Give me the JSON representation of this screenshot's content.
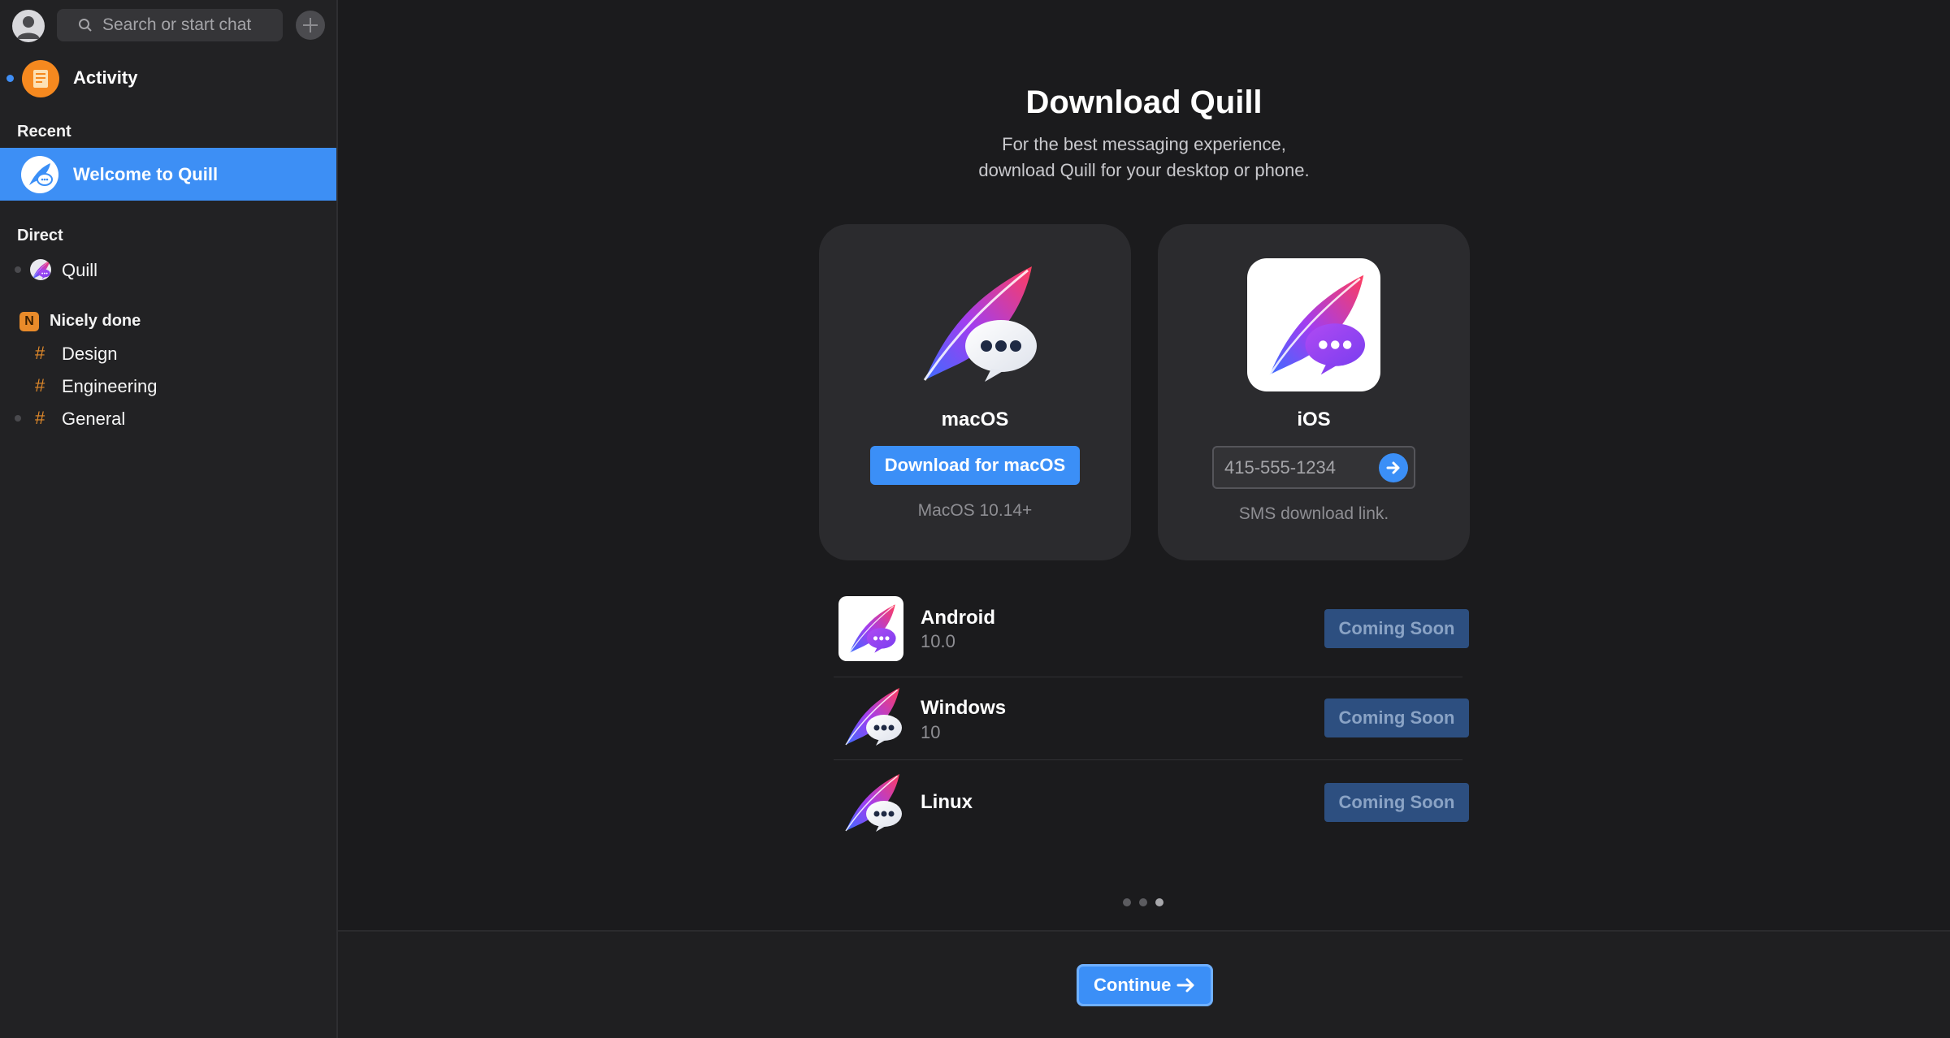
{
  "sidebar": {
    "search_placeholder": "Search or start chat",
    "activity_label": "Activity",
    "recent_title": "Recent",
    "recent_item": "Welcome to Quill",
    "direct_title": "Direct",
    "direct_item": "Quill",
    "team_badge": "N",
    "team_name": "Nicely done",
    "channels": [
      {
        "hash": "#",
        "name": "Design"
      },
      {
        "hash": "#",
        "name": "Engineering"
      },
      {
        "hash": "#",
        "name": "General"
      }
    ]
  },
  "main": {
    "title": "Download Quill",
    "subtitle_line1": "For the best messaging experience,",
    "subtitle_line2": "download Quill for your desktop or phone.",
    "mac": {
      "platform": "macOS",
      "button": "Download for macOS",
      "hint": "MacOS 10.14+"
    },
    "ios": {
      "platform": "iOS",
      "phone_placeholder": "415-555-1234",
      "hint": "SMS download link."
    },
    "platforms": [
      {
        "name": "Android",
        "version": "10.0",
        "status": "Coming Soon"
      },
      {
        "name": "Windows",
        "version": "10",
        "status": "Coming Soon"
      },
      {
        "name": "Linux",
        "version": "",
        "status": "Coming Soon"
      }
    ],
    "continue_label": "Continue"
  },
  "colors": {
    "accent": "#3b8ff7",
    "sidebar_bg": "#222224",
    "main_bg": "#1b1b1d",
    "card_bg": "#2b2b2e",
    "channel_hash": "#e0892a",
    "activity_orange": "#f6891f"
  },
  "icons": {
    "search": "search-icon",
    "add": "plus-icon",
    "user": "user-avatar-icon",
    "activity": "activity-icon",
    "quill_logo": "quill-feather-chat-icon",
    "arrow": "arrow-right-icon"
  }
}
